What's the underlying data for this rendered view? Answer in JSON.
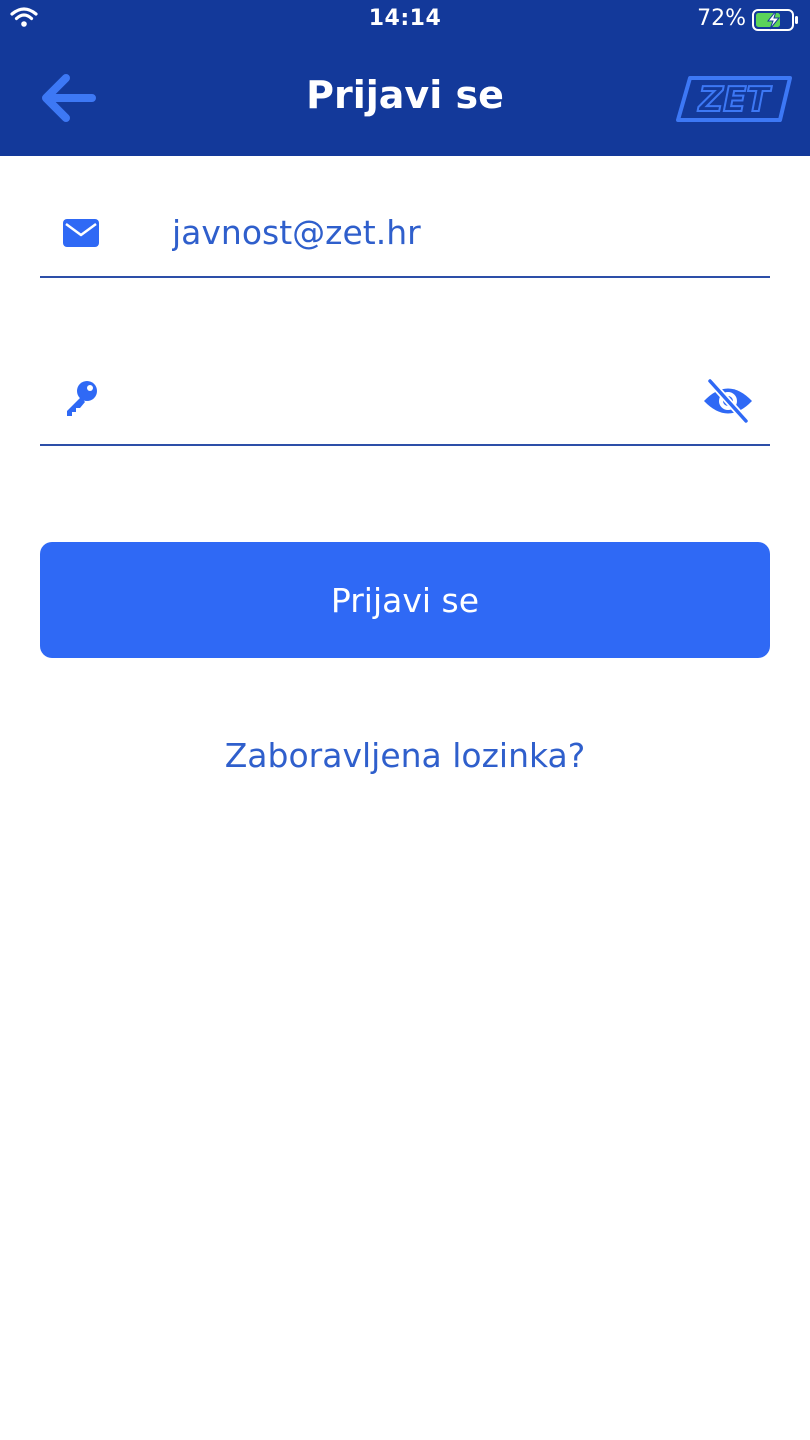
{
  "status_bar": {
    "time": "14:14",
    "battery_percent": "72%",
    "wifi_icon": "wifi-icon",
    "battery_icon": "battery-charging-icon"
  },
  "header": {
    "title": "Prijavi se",
    "back_icon": "arrow-left-icon",
    "logo_text": "ZET"
  },
  "form": {
    "email": {
      "value": "javnost@zet.hr",
      "icon": "envelope-icon"
    },
    "password": {
      "value": "",
      "icon": "key-icon",
      "toggle_icon": "eye-slash-icon"
    },
    "submit_label": "Prijavi se",
    "forgot_label": "Zaboravljena lozinka?"
  },
  "colors": {
    "header_bg": "#13399a",
    "accent": "#2f69f5",
    "link": "#2f5fcc",
    "battery_fill": "#5cd45a"
  }
}
